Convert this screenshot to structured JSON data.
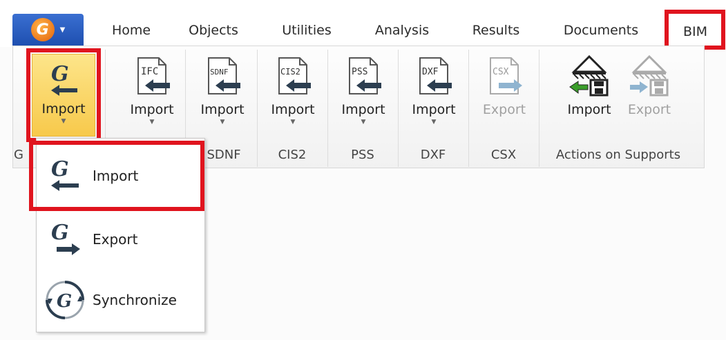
{
  "ribbon": {
    "app_menu": {
      "logo_letter": "G",
      "icon": "app-menu-chevron-icon"
    },
    "tabs": [
      "Home",
      "Objects",
      "Utilities",
      "Analysis",
      "Results",
      "Documents",
      "BIM"
    ],
    "active_tab": "BIM",
    "groups": {
      "g": {
        "label": "G",
        "button": {
          "label": "Import",
          "icon": "g-import-icon"
        }
      },
      "ifc": {
        "button": {
          "label": "Import",
          "icon": "ifc-import-icon",
          "badge": "IFC"
        }
      },
      "sdnf": {
        "label": "SDNF",
        "button": {
          "label": "Import",
          "icon": "sdnf-import-icon",
          "badge": "SDNF"
        }
      },
      "cis2": {
        "label": "CIS2",
        "button": {
          "label": "Import",
          "icon": "cis2-import-icon",
          "badge": "CIS2"
        }
      },
      "pss": {
        "label": "PSS",
        "button": {
          "label": "Import",
          "icon": "pss-import-icon",
          "badge": "PSS"
        }
      },
      "dxf": {
        "label": "DXF",
        "button": {
          "label": "Import",
          "icon": "dxf-import-icon",
          "badge": "DXF"
        }
      },
      "csx": {
        "label": "CSX",
        "button": {
          "label": "Export",
          "icon": "csx-export-icon",
          "badge": "CSX",
          "disabled": true
        }
      },
      "supports": {
        "label": "Actions on Supports",
        "import_label": "Import",
        "export_label": "Export",
        "import_icon": "supports-import-icon",
        "export_icon": "supports-export-icon"
      }
    }
  },
  "dropdown": {
    "items": [
      {
        "label": "Import",
        "icon": "g-import-icon"
      },
      {
        "label": "Export",
        "icon": "g-export-icon"
      },
      {
        "label": "Synchronize",
        "icon": "g-sync-icon"
      }
    ]
  },
  "colors": {
    "highlight_red": "#e0141e",
    "hover_yellow": "#f7c94b",
    "arrow_dark": "#2c3e50",
    "arrow_green": "#3a9d2a",
    "arrow_disabled": "#8fb4d0"
  }
}
